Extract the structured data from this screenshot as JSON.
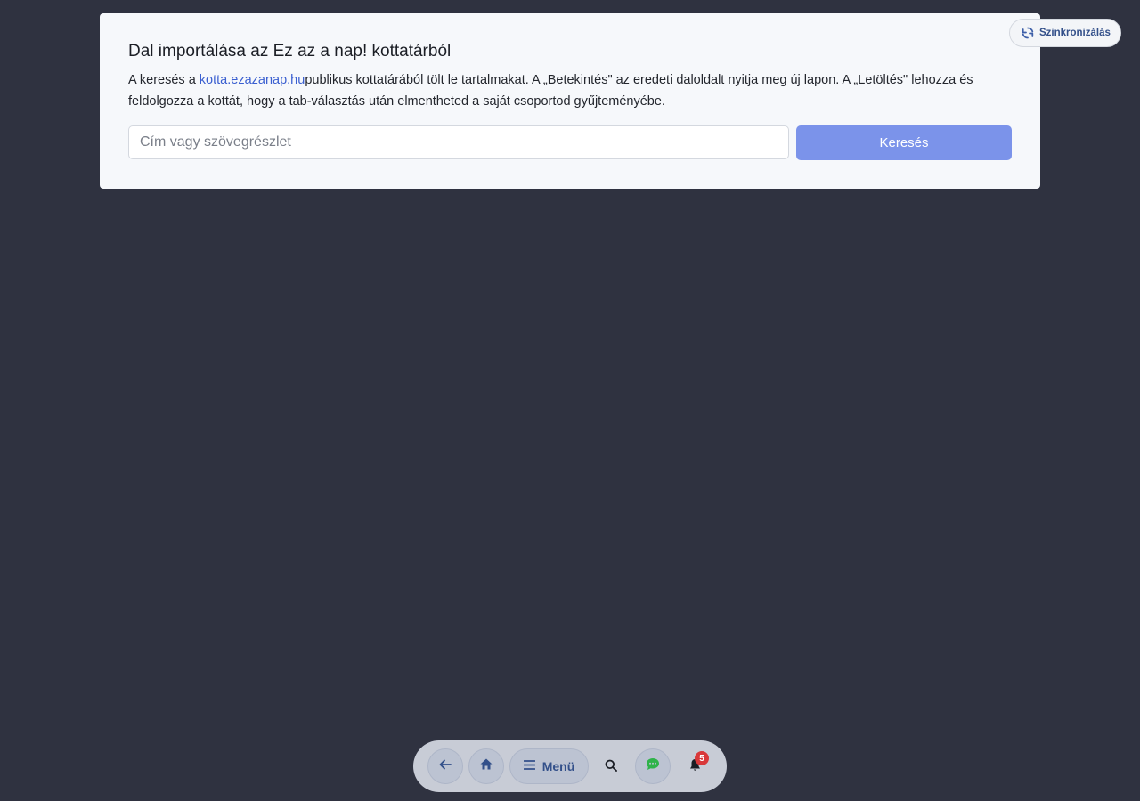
{
  "import_card": {
    "title": "Dal importálása az Ez az a nap! kottatárból",
    "desc_prefix": "A keresés a ",
    "desc_link": "kotta.ezazanap.hu",
    "desc_suffix": "publikus kottatárából tölt le tartalmakat. A „Betekintés\" az eredeti daloldalt nyitja meg új lapon. A „Letöltés\" lehozza és feldolgozza a kottát, hogy a tab-választás után elmentheted a saját csoportod gyűjteményébe.",
    "search": {
      "placeholder": "Cím vagy szövegrészlet",
      "value": "",
      "button_label": "Keresés"
    }
  },
  "sync": {
    "label": "Szinkronizálás",
    "icon": "sync-icon"
  },
  "bottom_nav": {
    "back_icon": "arrow-left-icon",
    "home_icon": "home-icon",
    "menu_icon": "hamburger-icon",
    "menu_label": "Menü",
    "search_icon": "search-icon",
    "chat_icon": "chat-icon",
    "bell_icon": "bell-icon",
    "notification_count": "5"
  },
  "colors": {
    "background": "#2f3240",
    "card": "#f6f8fb",
    "accent": "#7b93ea",
    "link": "#3a5fd0",
    "nav_text": "#33508a",
    "chat_green": "#2fb34a",
    "badge_red": "#d9383a"
  }
}
